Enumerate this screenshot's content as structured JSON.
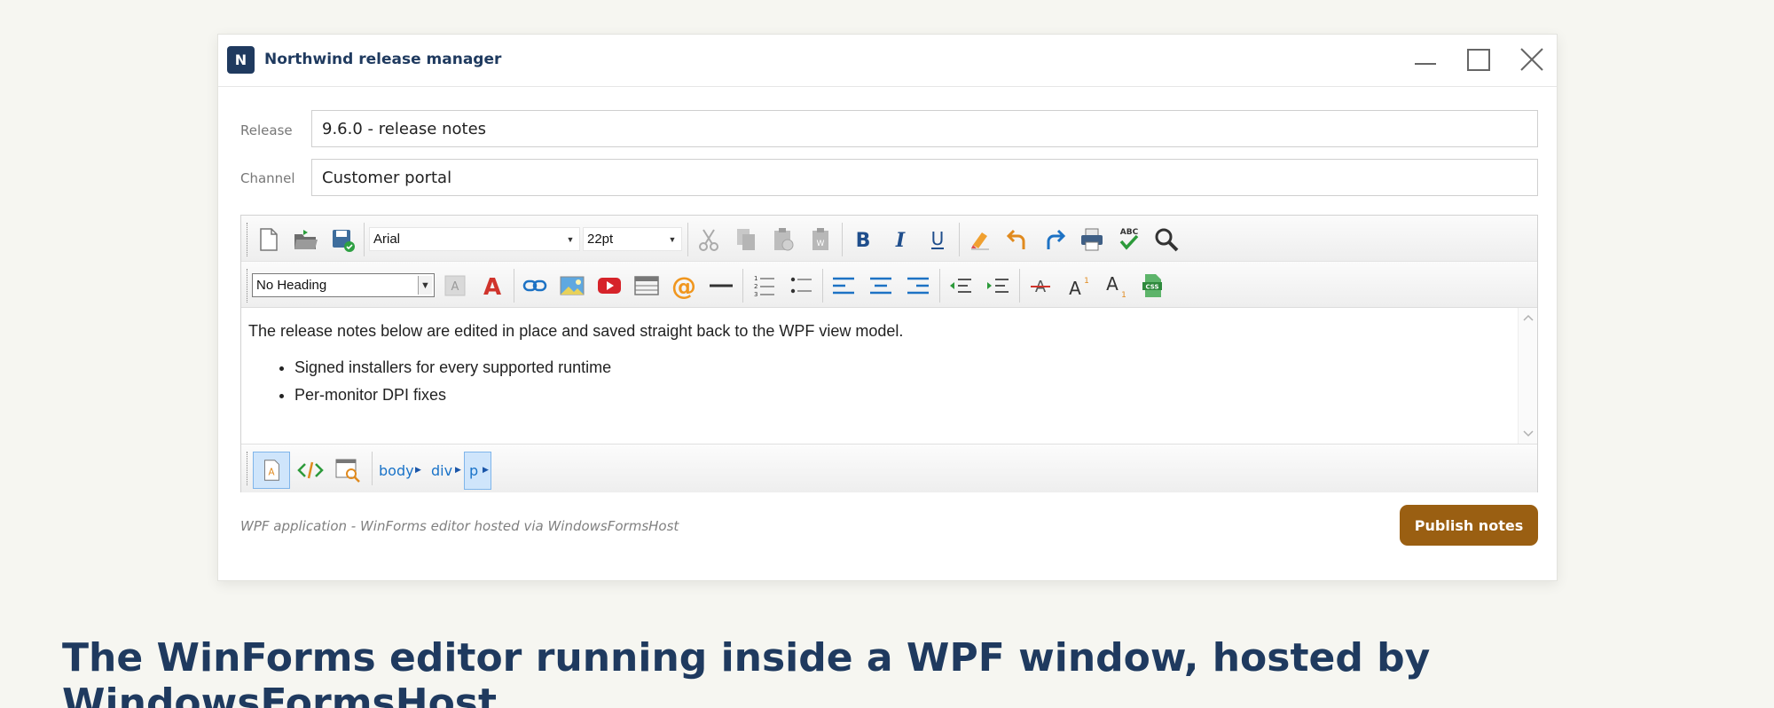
{
  "window": {
    "logo_letter": "N",
    "title": "Northwind release manager"
  },
  "form": {
    "release_label": "Release",
    "release_value": "9.6.0 - release notes",
    "channel_label": "Channel",
    "channel_value": "Customer portal"
  },
  "toolbar": {
    "font_name": "Arial",
    "font_size": "22pt",
    "heading": "No Heading",
    "icons_row1": [
      "new-document-icon",
      "open-folder-icon",
      "save-icon",
      "cut-icon",
      "copy-icon",
      "paste-icon",
      "paste-from-word-icon",
      "bold-icon",
      "italic-icon",
      "underline-icon",
      "clear-format-icon",
      "undo-icon",
      "redo-icon",
      "print-icon",
      "spell-check-icon",
      "find-icon"
    ],
    "icons_row2": [
      "highlight-color-icon",
      "font-color-icon",
      "link-icon",
      "image-icon",
      "youtube-icon",
      "table-icon",
      "email-icon",
      "horizontal-rule-icon",
      "ordered-list-icon",
      "bullet-list-icon",
      "align-left-icon",
      "align-center-icon",
      "align-right-icon",
      "outdent-icon",
      "indent-icon",
      "strikethrough-icon",
      "superscript-icon",
      "subscript-icon",
      "css-icon"
    ],
    "bold_glyph": "B",
    "italic_glyph": "I",
    "underline_glyph": "U",
    "spell_glyph": "ABC",
    "css_glyph": "CSS"
  },
  "document": {
    "intro": "The release notes below are edited in place and saved straight back to the WPF view model.",
    "bullets": [
      "Signed installers for every supported runtime",
      "Per-monitor DPI fixes"
    ]
  },
  "statusbar": {
    "modes": [
      "design-mode-icon",
      "code-mode-icon",
      "preview-mode-icon"
    ],
    "breadcrumb": [
      "body",
      "div",
      "p"
    ]
  },
  "footer": {
    "note": "WPF application - WinForms editor hosted via WindowsFormsHost",
    "publish_label": "Publish notes"
  },
  "caption": "The WinForms editor running inside a WPF window, hosted by WindowsFormsHost.",
  "colors": {
    "accent": "#1f3a5f",
    "publish": "#9a5f12",
    "selection": "#cfe5fb"
  }
}
